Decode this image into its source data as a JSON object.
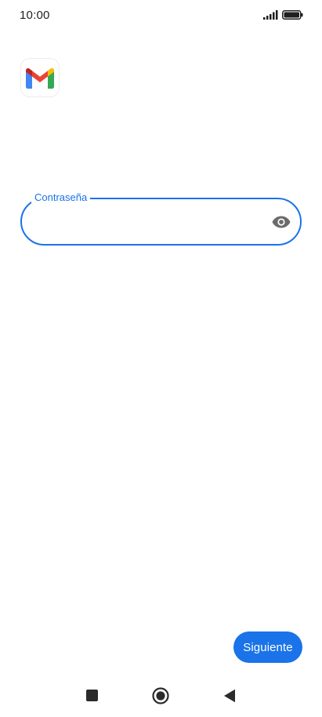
{
  "status_bar": {
    "time": "10:00",
    "signal_icon": "signal-icon",
    "battery_icon": "battery-icon"
  },
  "app": {
    "logo_icon": "gmail-logo-icon"
  },
  "password_field": {
    "label": "Contraseña",
    "value": "",
    "toggle_icon": "eye-icon"
  },
  "actions": {
    "next_label": "Siguiente"
  },
  "nav_bar": {
    "recents_icon": "square-icon",
    "home_icon": "circle-icon",
    "back_icon": "triangle-back-icon"
  },
  "colors": {
    "accent": "#1a73e8",
    "background": "#ffffff",
    "text": "#1f1f1f",
    "eye_icon": "#6b6b6b"
  }
}
